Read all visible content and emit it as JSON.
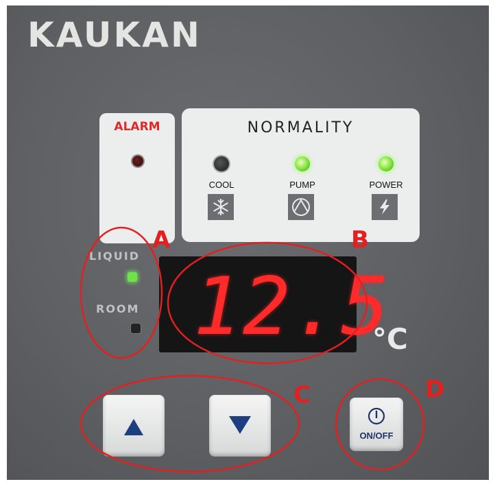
{
  "brand": {
    "text": "KAUKAN"
  },
  "alarm": {
    "label": "ALARM"
  },
  "normality": {
    "title": "NORMALITY",
    "indicators": [
      {
        "label": "COOL",
        "state": "off",
        "icon": "snowflake-icon"
      },
      {
        "label": "PUMP",
        "state": "on",
        "icon": "pump-icon"
      },
      {
        "label": "POWER",
        "state": "on",
        "icon": "lightning-icon"
      }
    ]
  },
  "sensor": {
    "liquid_label": "LIQUID",
    "room_label": "ROOM",
    "liquid_state": "on",
    "room_state": "off"
  },
  "display": {
    "value": "12.5",
    "unit": "°C"
  },
  "controls": {
    "up_icon": "arrow-up-icon",
    "down_icon": "arrow-down-icon",
    "onoff_label": "ON/OFF"
  },
  "annotations": {
    "a": "A",
    "b": "B",
    "c": "C",
    "d": "D"
  },
  "colors": {
    "panel": "#5e6063",
    "annotation": "#e32020",
    "led_green": "#7ee03a",
    "seven_segment": "#ff2a2a"
  }
}
